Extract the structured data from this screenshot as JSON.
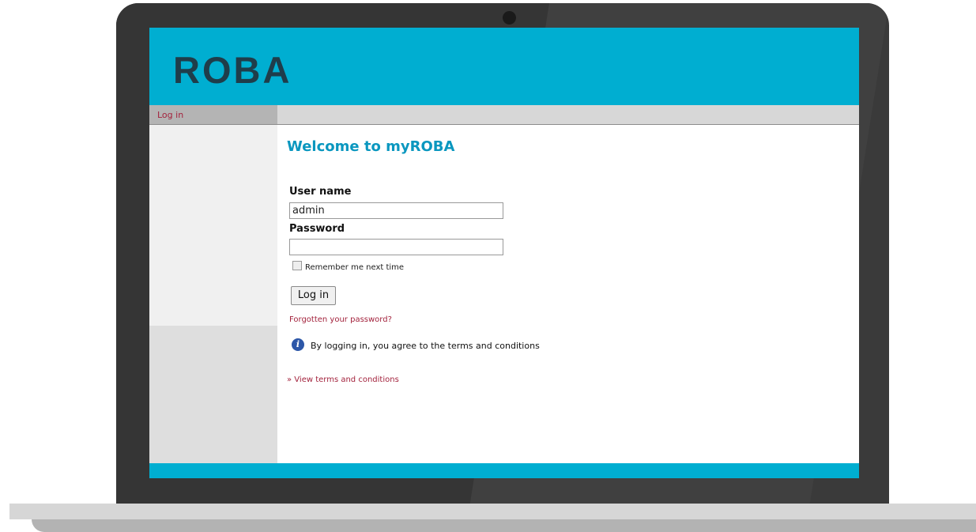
{
  "header": {
    "logo": "ROBA"
  },
  "nav": {
    "login_label": "Log in"
  },
  "main": {
    "title": "Welcome to myROBA",
    "username_label": "User name",
    "username_value": "admin",
    "password_label": "Password",
    "password_value": "",
    "remember_label": "Remember me next time",
    "remember_checked": false,
    "login_button": "Log in",
    "forgot_link": "Forgotten your password?",
    "agree_text": "By logging in, you agree to the terms and conditions",
    "terms_link": "» View terms and conditions"
  },
  "icons": {
    "info": "info-icon"
  },
  "colors": {
    "brand": "#00aed1",
    "link": "#a3233d",
    "title": "#0a97bf",
    "logo": "#1f3d4a"
  }
}
